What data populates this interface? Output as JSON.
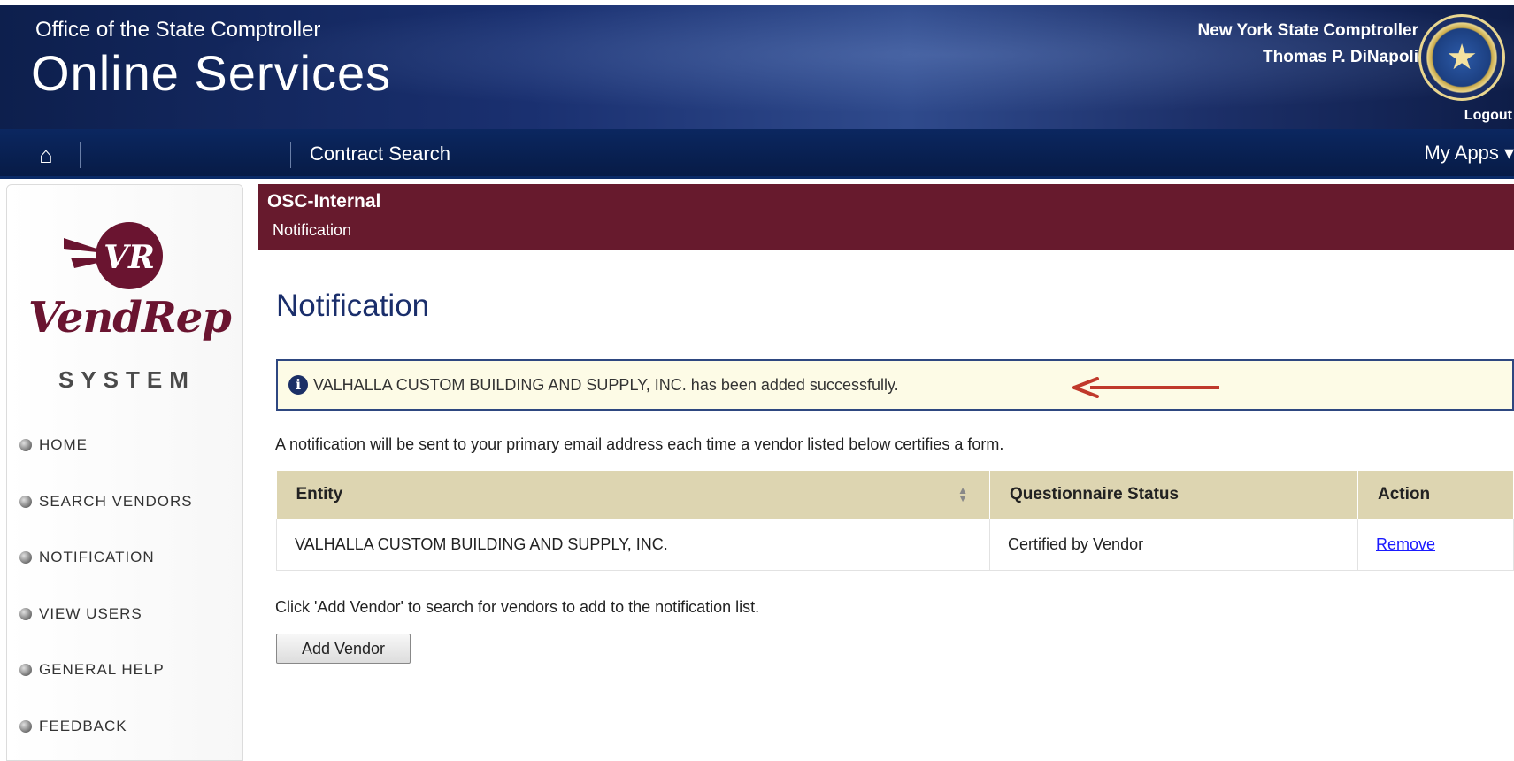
{
  "header": {
    "brand_top": "Office of the State Comptroller",
    "brand_main": "Online Services",
    "comptroller_line1": "New York State Comptroller",
    "comptroller_line2": "Thomas P. DiNapoli",
    "logout_label": "Logout"
  },
  "navbar": {
    "home_icon": "home-icon",
    "items": [
      {
        "label": "Contract Search"
      }
    ],
    "my_apps_label": "My Apps ▾"
  },
  "sidebar": {
    "logo_text": "VendRep",
    "logo_sub": "SYSTEM",
    "logo_badge": "VR",
    "items": [
      {
        "label": "HOME"
      },
      {
        "label": "SEARCH VENDORS"
      },
      {
        "label": "NOTIFICATION"
      },
      {
        "label": "VIEW USERS"
      },
      {
        "label": "GENERAL HELP"
      },
      {
        "label": "FEEDBACK"
      }
    ]
  },
  "main": {
    "banner_title": "OSC-Internal",
    "banner_sub": "Notification",
    "page_title": "Notification",
    "alert_message": "VALHALLA CUSTOM BUILDING AND SUPPLY, INC. has been added successfully.",
    "notice_text": "A notification will be sent to your primary email address each time a vendor listed below certifies a form.",
    "table": {
      "headers": [
        "Entity",
        "Questionnaire Status",
        "Action"
      ],
      "rows": [
        {
          "entity": "VALHALLA CUSTOM BUILDING AND SUPPLY, INC.",
          "status": "Certified by Vendor",
          "action": "Remove"
        }
      ]
    },
    "hint_text": "Click 'Add Vendor' to search for vendors to add to the notification list.",
    "add_vendor_label": "Add Vendor"
  },
  "colors": {
    "header_blue": "#1a3070",
    "banner_maroon": "#671a2d",
    "table_header": "#ddd5b1",
    "alert_bg": "#fdfbe6",
    "annotation_arrow": "#c0392b"
  }
}
